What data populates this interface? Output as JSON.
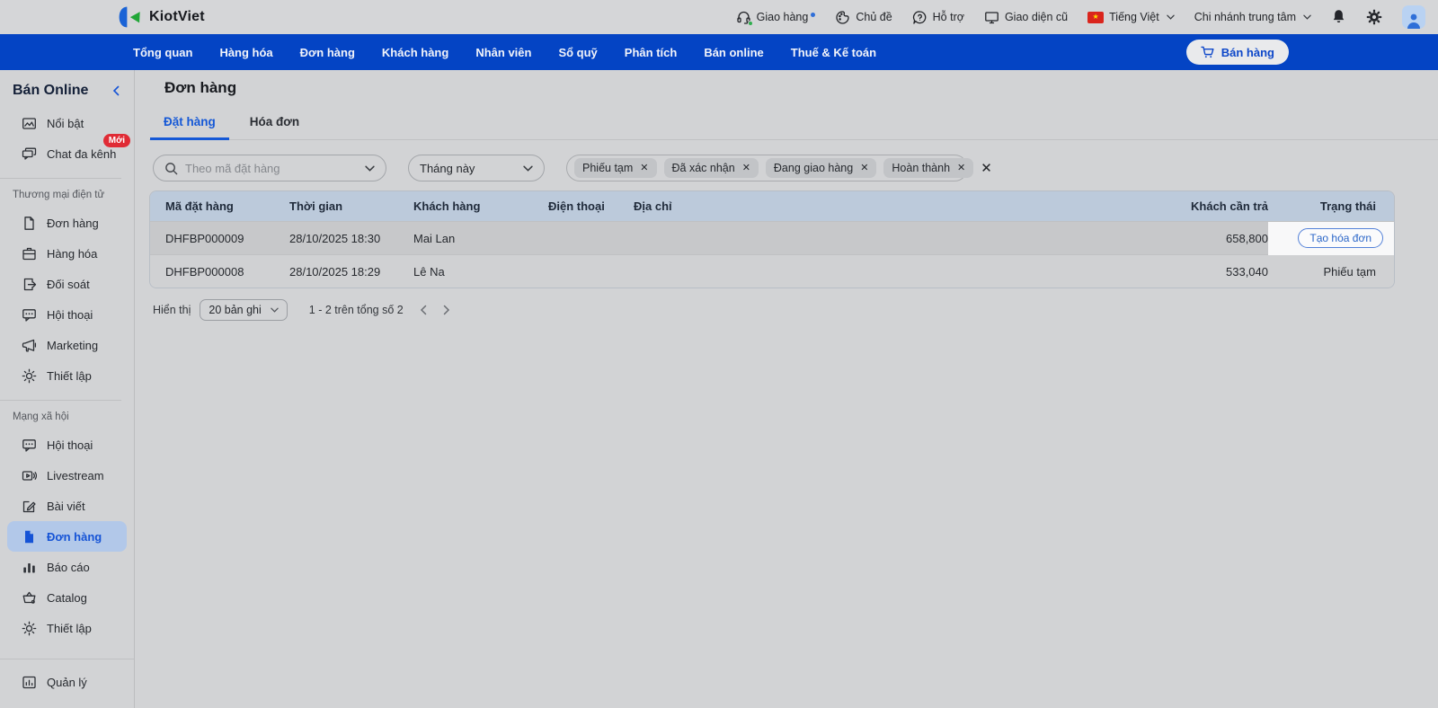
{
  "topbar": {
    "brand": "KiotViet",
    "items": [
      {
        "label": "Giao hàng",
        "icon": "headset-icon",
        "has_notification_dot": true
      },
      {
        "label": "Chủ đề",
        "icon": "palette-icon"
      },
      {
        "label": "Hỗ trợ",
        "icon": "support-icon"
      },
      {
        "label": "Giao diện cũ",
        "icon": "monitor-icon"
      },
      {
        "label": "Tiếng Việt",
        "icon": "vietnam-flag-icon",
        "has_chevron": true
      },
      {
        "label": "Chi nhánh trung tâm",
        "has_chevron": true
      }
    ]
  },
  "nav": {
    "items": [
      "Tổng quan",
      "Hàng hóa",
      "Đơn hàng",
      "Khách hàng",
      "Nhân viên",
      "Sổ quỹ",
      "Phân tích",
      "Bán online",
      "Thuế & Kế toán"
    ],
    "sell_button": "Bán hàng"
  },
  "sidebar": {
    "title": "Bán Online",
    "groups": [
      {
        "items": [
          {
            "label": "Nổi bật"
          },
          {
            "label": "Chat đa kênh",
            "badge": "Mới"
          }
        ]
      },
      {
        "header": "Thương mại điện tử",
        "items": [
          {
            "label": "Đơn hàng"
          },
          {
            "label": "Hàng hóa"
          },
          {
            "label": "Đối soát"
          },
          {
            "label": "Hội thoại"
          },
          {
            "label": "Marketing"
          },
          {
            "label": "Thiết lập"
          }
        ]
      },
      {
        "header": "Mạng xã hội",
        "items": [
          {
            "label": "Hội thoại"
          },
          {
            "label": "Livestream"
          },
          {
            "label": "Bài viết"
          },
          {
            "label": "Đơn hàng",
            "selected": true
          },
          {
            "label": "Báo cáo"
          },
          {
            "label": "Catalog"
          },
          {
            "label": "Thiết lập"
          }
        ]
      }
    ],
    "bottom_item": "Quản lý"
  },
  "main": {
    "title": "Đơn hàng",
    "tabs": [
      {
        "label": "Đặt hàng",
        "active": true
      },
      {
        "label": "Hóa đơn",
        "active": false
      }
    ],
    "filters": {
      "search_placeholder": "Theo mã đặt hàng",
      "period": "Tháng này",
      "chips": [
        "Phiếu tạm",
        "Đã xác nhận",
        "Đang giao hàng",
        "Hoàn thành"
      ]
    },
    "table": {
      "columns": [
        "Mã đặt hàng",
        "Thời gian",
        "Khách hàng",
        "Điện thoại",
        "Địa chỉ",
        "Khách cần trả",
        "Trạng thái"
      ],
      "rows": [
        {
          "code": "DHFBP000009",
          "time": "28/10/2025 18:30",
          "customer": "Mai Lan",
          "amount": "658,800",
          "action": "Tạo hóa đơn",
          "hovered": true
        },
        {
          "code": "DHFBP000008",
          "time": "28/10/2025 18:29",
          "customer": "Lê Na",
          "amount": "533,040",
          "status": "Phiếu tạm"
        }
      ]
    },
    "pagination": {
      "show_label": "Hiển thị",
      "page_size": "20 bản ghi",
      "range": "1 - 2 trên tổng số 2"
    }
  },
  "icons": {
    "close": "✕",
    "star": "★"
  },
  "colors": {
    "nav_blue": "#0444c4",
    "accent_blue": "#1553d6",
    "badge_red": "#e02b35",
    "table_header": "#bccadb",
    "selected_item_bg": "#b2c8e9",
    "page_background": "#d2d3d5"
  }
}
